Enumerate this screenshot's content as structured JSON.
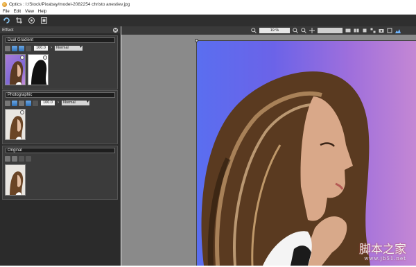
{
  "window": {
    "title": "Optics : I:/Stock/Pixabay/model-2082254 christo anestiev.jpg"
  },
  "menu": {
    "items": [
      "File",
      "Edit",
      "View",
      "Help"
    ]
  },
  "panel": {
    "title": "Effect",
    "layers": [
      {
        "name": "Dual Gradient",
        "opacity": "100.0",
        "blend": "Normal"
      },
      {
        "name": "Photographic",
        "opacity": "100.0",
        "blend": "Normal"
      },
      {
        "name": "Original"
      }
    ]
  },
  "canvas": {
    "zoom": "19 %"
  },
  "watermark": {
    "text": "脚本之家",
    "url": "www.jb51.net"
  }
}
